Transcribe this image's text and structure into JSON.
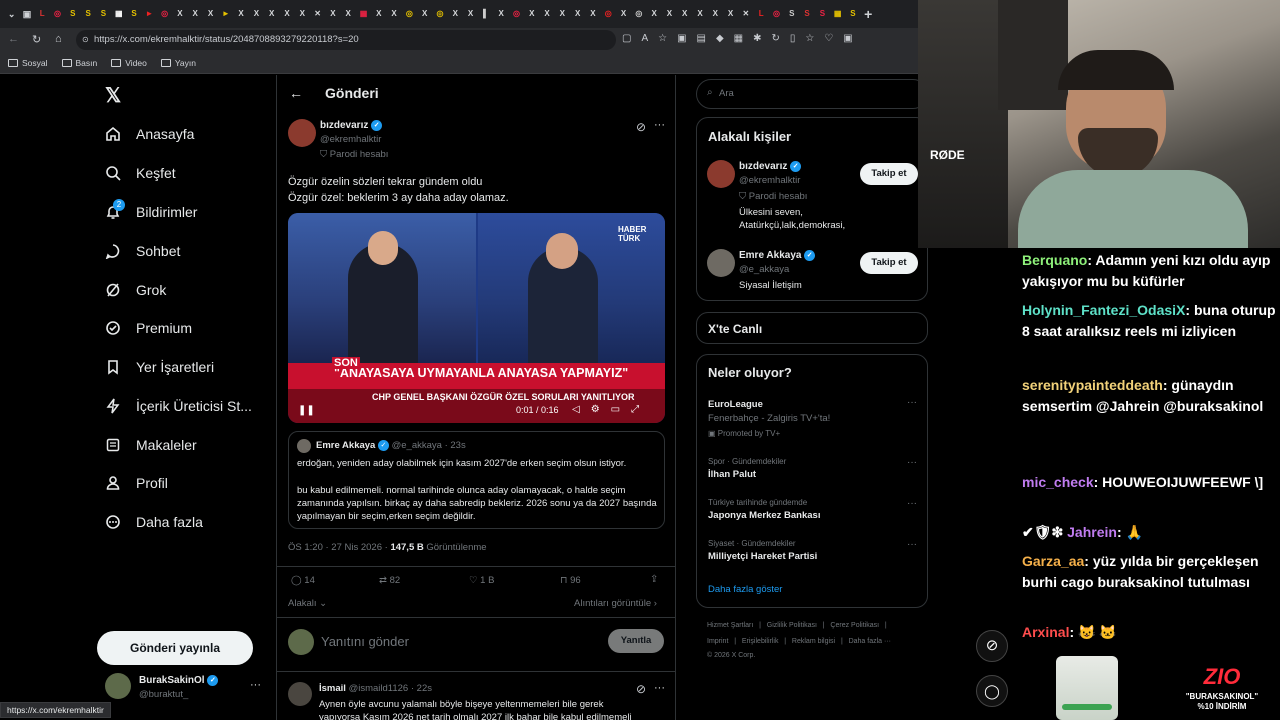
{
  "browser": {
    "url": "https://x.com/ekremhalktir/status/2048708893279220118?s=20",
    "bookmarks": [
      "Sosyal",
      "Basın",
      "Video",
      "Yayın"
    ],
    "status_url": "https://x.com/ekremhalktir"
  },
  "nav": {
    "items": [
      "Anasayfa",
      "Keşfet",
      "Bildirimler",
      "Sohbet",
      "Grok",
      "Premium",
      "Yer İşaretleri",
      "İçerik Üreticisi St...",
      "Makaleler",
      "Profil",
      "Daha fazla"
    ],
    "notif_badge": "2",
    "post_button": "Gönderi yayınla",
    "account_name": "BurakSakinOl",
    "account_handle": "@buraktut_"
  },
  "header": {
    "title": "Gönderi"
  },
  "tweet": {
    "name": "bızdevarız",
    "handle": "@ekremhalktir",
    "parody": "Parodi hesabı",
    "text_line1": "Özgür özelin sözleri tekrar gündem oldu",
    "text_line2": "Özgür özel: beklerim 3 ay daha aday olamaz.",
    "video": {
      "banner": "\"ANAYASAYA UYMAYANLA ANAYASA YAPMAYIZ\"",
      "sub": "CHP GENEL BAŞKANI ÖZGÜR ÖZEL SORULARI YANITLIYOR",
      "son": "SON",
      "channel": "HABER TÜRK",
      "time": "0:01 / 0:16"
    },
    "quote": {
      "name": "Emre Akkaya",
      "handle": "@e_akkaya",
      "time": "· 23s",
      "p1": "erdoğan, yeniden aday olabilmek için kasım 2027'de erken seçim olsun istiyor.",
      "p2": "bu kabul edilmemeli. normal tarihinde olunca aday olamayacak, o halde seçim zamanında yapılsın. birkaç ay daha sabredip bekleriz. 2026 sonu ya da 2027 başında yapılmayan bir seçim,erken seçim değildir."
    },
    "meta_time": "ÖS 1:20 · 27 Nis 2026 · ",
    "views": "147,5 B",
    "views_label": " Görüntülenme",
    "replies": "14",
    "reposts": "82",
    "likes": "1 B",
    "bookmarks": "96",
    "relevant": "Alakalı",
    "quotes": "Alıntıları görüntüle",
    "reply_placeholder": "Yanıtını gönder",
    "reply_btn": "Yanıtla"
  },
  "reply": {
    "name": "İsmail",
    "handle": "@ismaild1126",
    "time": "· 22s",
    "text": "Aynen öyle avcunu yalamalı böyle bişeye yeltenmemeleri bile gerek",
    "text2": "yapıyorsa Kasım 2026 net tarih olmalı 2027 ilk bahar bile kabul edilmemeli"
  },
  "right": {
    "search_placeholder": "Ara",
    "related_title": "Alakalı kişiler",
    "people": [
      {
        "name": "bızdevarız",
        "handle": "@ekremhalktir",
        "tag": "Parodi hesabı",
        "bio": "Ülkesini seven, Atatürkçü,lalk,demokrasi,",
        "btn": "Takip et"
      },
      {
        "name": "Emre Akkaya",
        "handle": "@e_akkaya",
        "tag": "",
        "bio": "Siyasal İletişim",
        "btn": "Takip et"
      }
    ],
    "live_title": "X'te Canlı",
    "trends_title": "Neler oluyor?",
    "trends": [
      {
        "meta": "EuroLeague",
        "title": "Fenerbahçe - Zalgiris TV+'ta!",
        "sub": "Promoted by TV+"
      },
      {
        "meta": "Spor · Gündemdekiler",
        "title": "İlhan Palut",
        "sub": ""
      },
      {
        "meta": "Türkiye tarihinde gündemde",
        "title": "Japonya Merkez Bankası",
        "sub": ""
      },
      {
        "meta": "Siyaset · Gündemdekiler",
        "title": "Milliyetçi Hareket Partisi",
        "sub": ""
      }
    ],
    "show_more": "Daha fazla göster",
    "footer1": "Hizmet Şartları   |   Gizlilik Politikası   |   Çerez Politikası   |",
    "footer2": "Imprint   |   Erişilebilirlik   |   Reklam bilgisi   |   Daha fazla ···",
    "copyright": "© 2026 X Corp."
  },
  "chat": [
    {
      "user": "Berquano",
      "color": "#8ef07a",
      "msg": "Adamın yeni kızı oldu ayıp yakışıyor mu bu küfürler"
    },
    {
      "user": "Holynin_Fantezi_OdasiX",
      "color": "#5ee1c8",
      "msg": "buna oturup 8 saat aralıksız reels mi izliyicen"
    },
    {
      "user": "serenitypainteddeath",
      "color": "#f2d27a",
      "msg": "günaydın semsertim @Jahrein @buraksakinol"
    },
    {
      "user": "mic_check",
      "color": "#c07cf0",
      "msg": "HOUWEOIJUWFEEWF \\]"
    },
    {
      "user": "Jahrein",
      "color": "#c07cf0",
      "msg": "🙏"
    },
    {
      "user": "Garza_aa",
      "color": "#f5b04a",
      "msg": "yüz yılda bir gerçekleşen burhi cago buraksakinol tutulması"
    },
    {
      "user": "Arxinal",
      "color": "#ff4d4d",
      "msg": ""
    }
  ],
  "promo": {
    "brand": "ZIO",
    "code": "\"BURAKSAKINOL\"",
    "discount": "%10 İNDİRİM"
  },
  "webcam": {
    "mic_brand": "RØDE"
  }
}
